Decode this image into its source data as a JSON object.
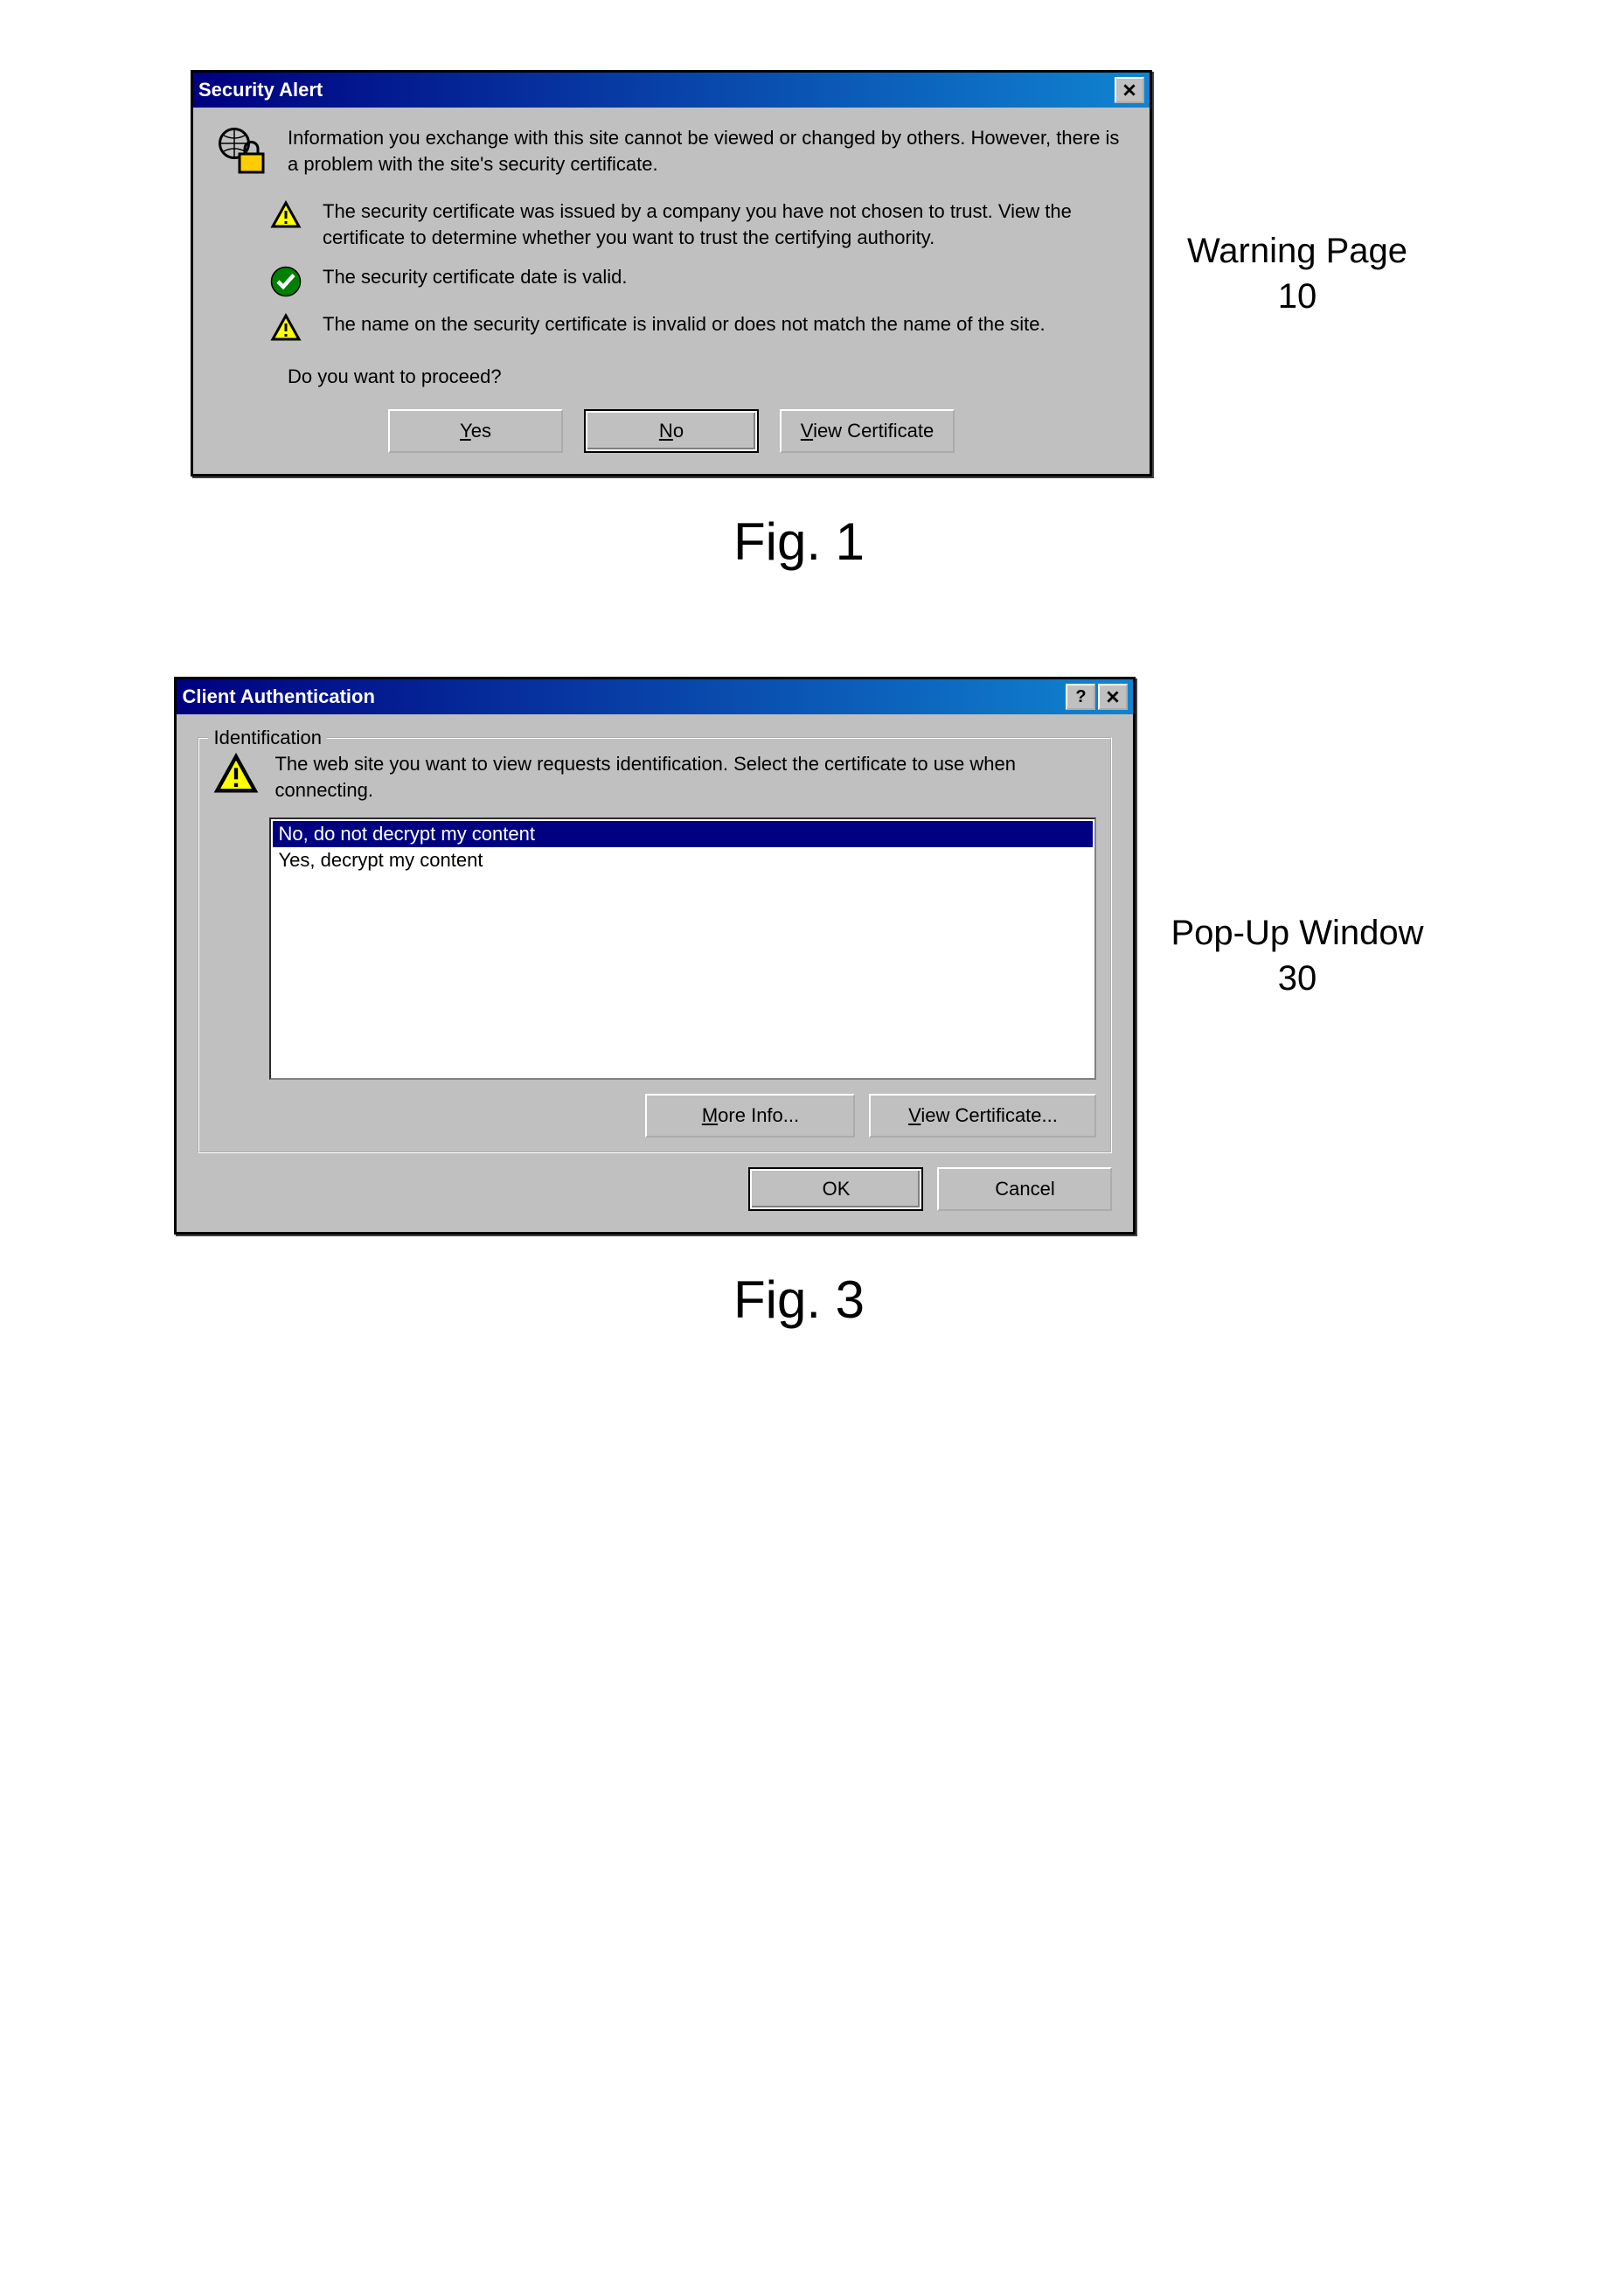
{
  "fig1": {
    "title": "Security Alert",
    "intro": "Information you exchange with this site cannot be viewed or changed by others. However, there is a problem with the site's security certificate.",
    "bullets": [
      "The security certificate was issued by a company you have not chosen to trust. View the certificate to determine whether you want to trust the certifying authority.",
      "The security certificate date is valid.",
      "The name on the security certificate is invalid or does not match the name of the site."
    ],
    "proceed": "Do you want to proceed?",
    "buttons": {
      "yes": "Yes",
      "no": "No",
      "view": "View Certificate"
    },
    "side_label_1": "Warning Page",
    "side_label_2": "10",
    "caption": "Fig. 1"
  },
  "fig3": {
    "title": "Client Authentication",
    "group_label": "Identification",
    "instructions": "The web site you want to view requests identification. Select the certificate to use when connecting.",
    "options": [
      "No, do not decrypt my content",
      "Yes, decrypt my content"
    ],
    "selected_index": 0,
    "buttons": {
      "more": "More Info...",
      "view": "View Certificate...",
      "ok": "OK",
      "cancel": "Cancel"
    },
    "side_label_1": "Pop-Up Window",
    "side_label_2": "30",
    "caption": "Fig. 3"
  }
}
